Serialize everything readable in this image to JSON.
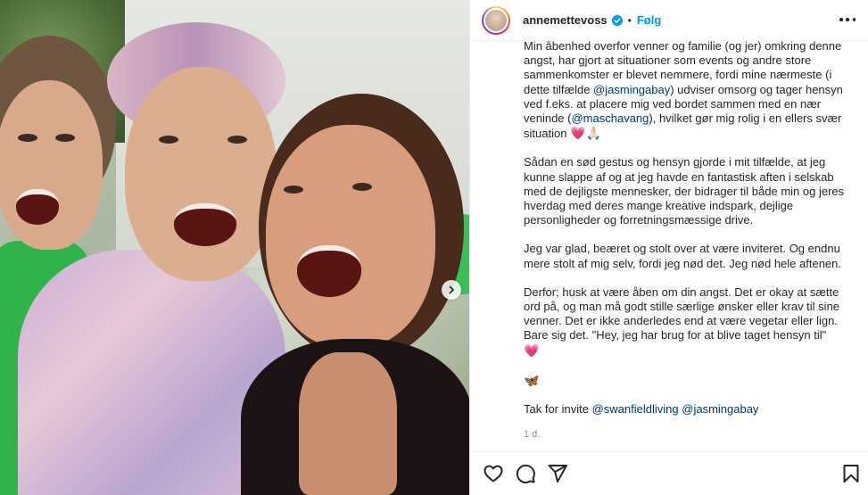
{
  "post": {
    "username": "annemettevoss",
    "separator": "•",
    "follow_label": "Følg",
    "timestamp": "1 d."
  },
  "caption": {
    "p1": [
      {
        "t": "Min åbenhed overfor venner og familie (og jer) omkring denne angst, har gjort at situationer som events og andre store sammenkomster er blevet nemmere, fordi mine nærmeste (i dette tilfælde "
      },
      {
        "m": "@jasmingabay"
      },
      {
        "t": ") udviser omsorg og tager hensyn ved f.eks. at placere mig ved bordet sammen med en nær veninde ("
      },
      {
        "m": "@maschavang"
      },
      {
        "t": "), hvilket gør mig rolig i en ellers svær situation "
      },
      {
        "e": "💗🙏🏻"
      }
    ],
    "p2": "Sådan en sød gestus og hensyn gjorde i mit tilfælde, at jeg kunne slappe af og at jeg havde en fantastisk aften i selskab med de dejligste mennesker, der bidrager til både min og jeres hverdag med deres mange kreative indspark, dejlige personligheder og forretningsmæssige drive.",
    "p3": "Jeg var glad, beæret og stolt over at være inviteret. Og endnu mere stolt af mig selv, fordi jeg nød det. Jeg nød hele aftenen.",
    "p4": "Derfor; husk at være åben om din angst. Det er okay at sætte ord på, og man må godt stille særlige ønsker eller krav til sine venner. Det er ikke anderledes end at være vegetar eller lign. Bare sig det. \"Hey, jeg har brug for at blive taget hensyn til\"",
    "p4_emoji": "💗",
    "p5_emoji": "🦋",
    "p6_text": "Tak for invite ",
    "p6_mention1": "@swanfieldliving",
    "p6_mention2": "@jasmingabay"
  },
  "icons": {
    "verified": "verified-badge-icon",
    "more": "more-options-icon",
    "carousel_next": "chevron-right-icon",
    "like": "heart-icon",
    "comment": "comment-icon",
    "share": "send-icon",
    "save": "bookmark-icon"
  },
  "colors": {
    "accent": "#0095f6",
    "mention": "#00376b",
    "text": "#262626",
    "muted": "#8e8e8e"
  }
}
